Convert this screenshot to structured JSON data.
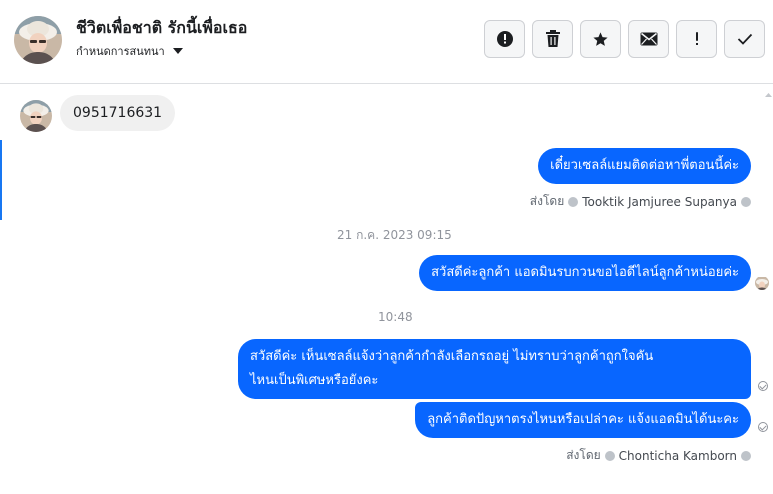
{
  "header": {
    "contact_name": "ชีวิตเพื่อชาติ รักนี้เพื่อเธอ",
    "contact_sub": "กำหนดการสนทนา",
    "actions": [
      {
        "icon": "alert-circle-icon"
      },
      {
        "icon": "trash-icon"
      },
      {
        "icon": "star-icon"
      },
      {
        "icon": "envelope-icon"
      },
      {
        "icon": "exclamation-icon"
      },
      {
        "icon": "check-icon"
      }
    ]
  },
  "messages": {
    "incoming_1": "0951716631",
    "outgoing_1": "เดี๋ยวเซลล์แยมติดต่อหาพี่ตอนนี้ค่ะ",
    "sent_by_1": {
      "label": "ส่งโดย",
      "name": "Tooktik Jamjuree Supanya"
    },
    "timestamp_1": "21 ก.ค. 2023 09:15",
    "outgoing_2": "สวัสดีค่ะลูกค้า แอดมินรบกวนขอไอดีไลน์ลูกค้าหน่อยค่ะ",
    "timestamp_2": "10:48",
    "outgoing_3_line1": "สวัสดีค่ะ เห็นเซลล์แจ้งว่าลูกค้ากำลังเลือกรถอยู่ ไม่ทราบว่าลูกค้าถูกใจคัน",
    "outgoing_3_line2": "ไหนเป็นพิเศษหรือยังคะ",
    "outgoing_4": "ลูกค้าติดปัญหาตรงไหนหรือเปล่าคะ แจ้งแอดมินได้นะคะ",
    "sent_by_2": {
      "label": "ส่งโดย",
      "name": "Chonticha Kamborn"
    }
  },
  "colors": {
    "accent": "#0866ff",
    "bubble_in": "#f0f0f0"
  }
}
